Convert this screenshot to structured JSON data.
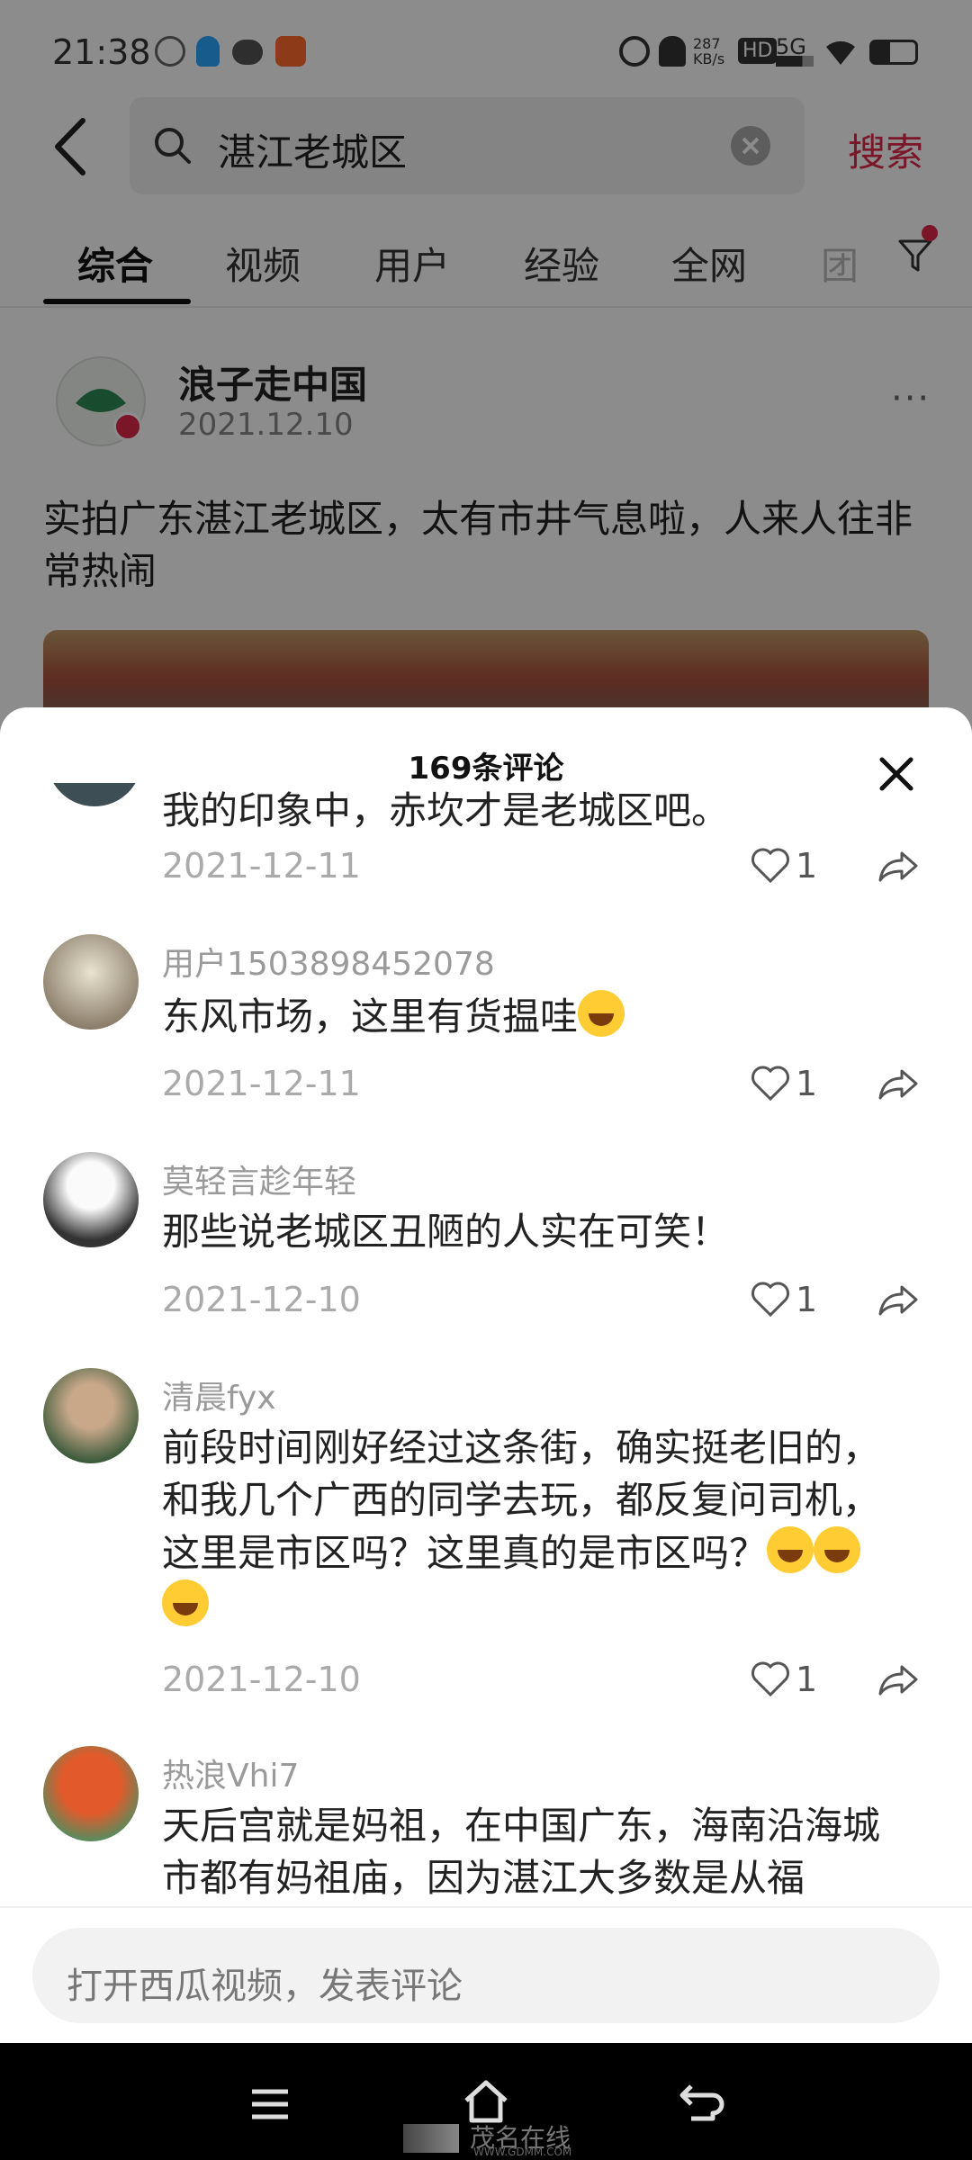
{
  "status_bar": {
    "time": "21:38",
    "network_speed": "287\nKB/s",
    "hd": "HD",
    "signal": "5G"
  },
  "search": {
    "query": "湛江老城区",
    "button": "搜索"
  },
  "tabs": [
    "综合",
    "视频",
    "用户",
    "经验",
    "全网",
    "团"
  ],
  "post": {
    "author": "浪子走中国",
    "date": "2021.12.10",
    "text": "实拍广东湛江老城区，太有市井气息啦，人来人往非常热闹",
    "more": "···"
  },
  "sheet": {
    "title": "169条评论"
  },
  "comments": [
    {
      "user": "",
      "text": "我的印象中，赤坎才是老城区吧。",
      "date": "2021-12-11",
      "likes": "1"
    },
    {
      "user": "用户1503898452078",
      "text": "东风市场，这里有货揾哇",
      "date": "2021-12-11",
      "likes": "1"
    },
    {
      "user": "莫轻言趁年轻",
      "text": "那些说老城区丑陋的人实在可笑！",
      "date": "2021-12-10",
      "likes": "1"
    },
    {
      "user": "清晨fyx",
      "text": "前段时间刚好经过这条街，确实挺老旧的，和我几个广西的同学去玩，都反复问司机，这里是市区吗？这里真的是市区吗？",
      "date": "2021-12-10",
      "likes": "1"
    },
    {
      "user": "热浪Vhi7",
      "text": "天后宫就是妈祖，在中国广东，海南沿海城市都有妈祖庙，因为湛江大多数是从福",
      "date": "",
      "likes": ""
    }
  ],
  "input": {
    "placeholder": "打开西瓜视频，发表评论"
  },
  "watermark": {
    "brand": "茂名在线",
    "url": "WWW.GDMM.COM"
  },
  "colors": {
    "accent": "#e0284a"
  }
}
